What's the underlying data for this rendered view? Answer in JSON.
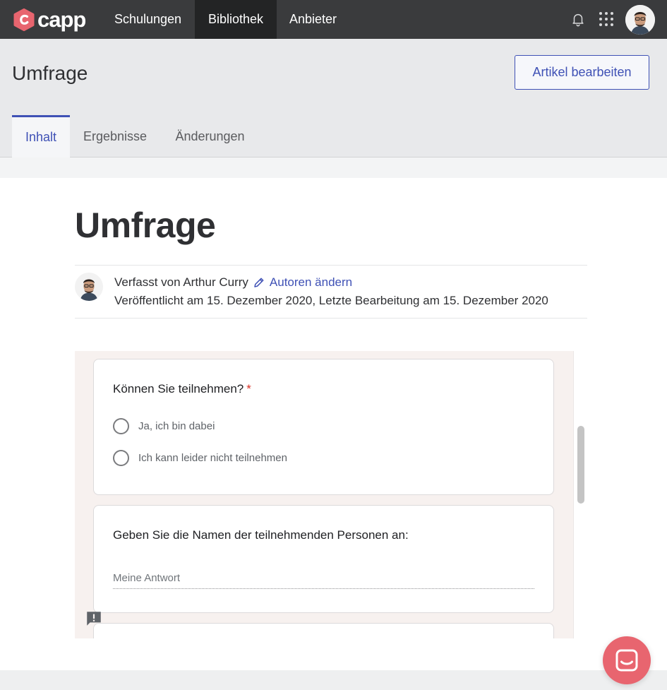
{
  "app": {
    "logo_text": "capp",
    "brand_color": "#e8656f",
    "accent_color": "#3f51b5"
  },
  "nav": {
    "items": [
      {
        "label": "Schulungen",
        "active": false
      },
      {
        "label": "Bibliothek",
        "active": true
      },
      {
        "label": "Anbieter",
        "active": false
      }
    ],
    "icons": [
      "bell-icon",
      "apps-grid-icon",
      "avatar"
    ]
  },
  "header": {
    "title": "Umfrage",
    "edit_button_label": "Artikel bearbeiten",
    "tabs": [
      {
        "label": "Inhalt",
        "active": true
      },
      {
        "label": "Ergebnisse",
        "active": false
      },
      {
        "label": "Änderungen",
        "active": false
      }
    ]
  },
  "article": {
    "title": "Umfrage",
    "author_text": "Verfasst von Arthur Curry",
    "change_authors_label": "Autoren ändern",
    "published_text": "Veröffentlicht am 15. Dezember 2020, Letzte Bearbeitung am 15. Dezember 2020"
  },
  "form": {
    "questions": [
      {
        "title": "Können Sie teilnehmen?",
        "required_mark": "*",
        "type": "radio",
        "options": [
          "Ja, ich bin dabei",
          "Ich kann leider nicht teilnehmen"
        ]
      },
      {
        "title": "Geben Sie die Namen der teilnehmenden Personen an:",
        "type": "text",
        "placeholder": "Meine Antwort"
      }
    ]
  },
  "chat": {
    "icon": "chat-icon"
  }
}
